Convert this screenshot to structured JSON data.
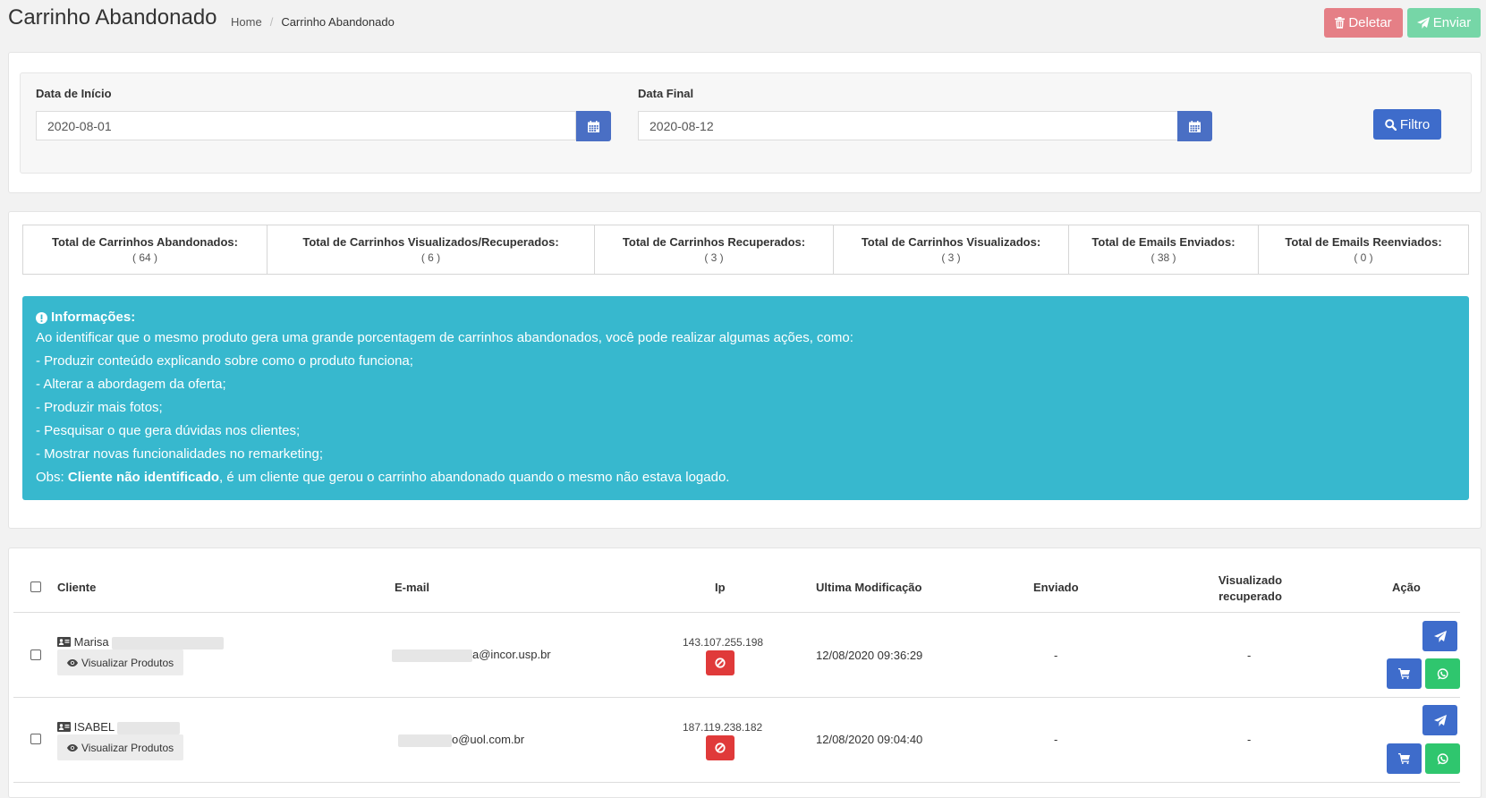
{
  "header": {
    "title": "Carrinho Abandonado",
    "breadcrumb": [
      "Home",
      "Carrinho Abandonado"
    ],
    "delete_label": "Deletar",
    "send_label": "Enviar"
  },
  "filter": {
    "start_label": "Data de Início",
    "start_value": "2020-08-01",
    "end_label": "Data Final",
    "end_value": "2020-08-12",
    "filter_label": "Filtro"
  },
  "stats": [
    {
      "label": "Total de Carrinhos Abandonados:",
      "value": "( 64 )"
    },
    {
      "label": "Total de Carrinhos Visualizados/Recuperados:",
      "value": "( 6 )"
    },
    {
      "label": "Total de Carrinhos Recuperados:",
      "value": "( 3 )"
    },
    {
      "label": "Total de Carrinhos Visualizados:",
      "value": "( 3 )"
    },
    {
      "label": "Total de Emails Enviados:",
      "value": "( 38 )"
    },
    {
      "label": "Total de Emails Reenviados:",
      "value": "( 0 )"
    }
  ],
  "info": {
    "title": "Informações:",
    "lines": [
      "Ao identificar que o mesmo produto gera uma grande porcentagem de carrinhos abandonados, você pode realizar algumas ações, como:",
      "- Produzir conteúdo explicando sobre como o produto funciona;",
      "- Alterar a abordagem da oferta;",
      "- Produzir mais fotos;",
      "- Pesquisar o que gera dúvidas nos clientes;",
      "- Mostrar novas funcionalidades no remarketing;"
    ],
    "obs_prefix": "Obs: ",
    "obs_bold": "Cliente não identificado",
    "obs_rest": ", é um cliente que gerou o carrinho abandonado quando o mesmo não estava logado."
  },
  "table": {
    "columns": {
      "cliente": "Cliente",
      "email": "E-mail",
      "ip": "Ip",
      "modified": "Ultima Modificação",
      "sent": "Enviado",
      "viewed_1": "Visualizado",
      "viewed_2": "recuperado",
      "action": "Ação"
    },
    "view_products_label": "Visualizar Produtos",
    "rows": [
      {
        "client": "Marisa",
        "email": "a@incor.usp.br",
        "ip": "143.107.255.198",
        "modified": "12/08/2020 09:36:29",
        "sent": "-",
        "viewed": "-"
      },
      {
        "client": "ISABEL",
        "email": "o@uol.com.br",
        "ip": "187.119.238.182",
        "modified": "12/08/2020 09:04:40",
        "sent": "-",
        "viewed": "-"
      }
    ]
  },
  "colors": {
    "danger_light": "#e57f86",
    "success_light": "#76d6a7",
    "primary": "#3e6ccb",
    "info": "#37b8ce",
    "danger": "#e03a3a",
    "whatsapp": "#2fc66e"
  },
  "icons": [
    "trash-icon",
    "paper-plane-icon",
    "calendar-icon",
    "search-icon",
    "exclamation-circle-icon",
    "id-card-icon",
    "eye-icon",
    "ban-icon",
    "cart-icon",
    "whatsapp-icon"
  ]
}
